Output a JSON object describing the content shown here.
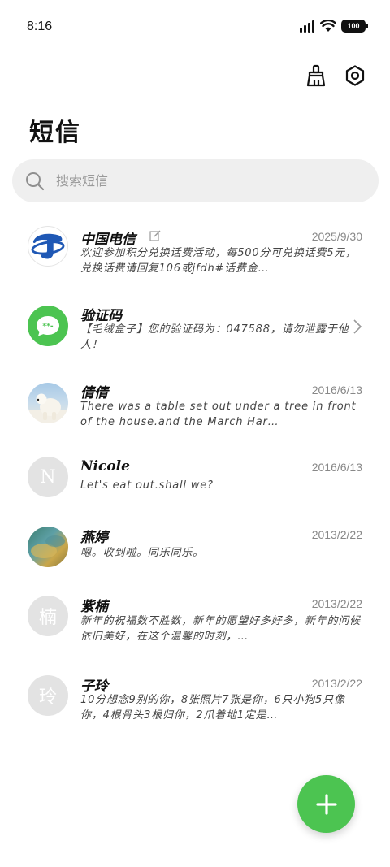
{
  "status_bar": {
    "time": "8:16",
    "battery": "100"
  },
  "header": {
    "title": "短信"
  },
  "search": {
    "placeholder": "搜索短信"
  },
  "messages": [
    {
      "name": "中国电信",
      "date": "2025/9/30",
      "preview": "欢迎参加积分兑换话费活动，每500分可兑换话费5元，兑换话费请回复106或jfdh#话费金…",
      "avatar": "china-telecom-logo"
    },
    {
      "name": "验证码",
      "date": "",
      "preview": "【毛绒盒子】您的验证码为：047588，请勿泄露于他人！",
      "avatar": "message-bubble"
    },
    {
      "name": "倩倩",
      "date": "2016/6/13",
      "preview": "There was a table set out under a tree in front of the house.and the March Har…",
      "avatar": "polar-bear-photo"
    },
    {
      "name": "Nicole",
      "date": "2016/6/13",
      "preview": "Let's eat out.shall we?",
      "avatar_letter": "N"
    },
    {
      "name": "燕婷",
      "date": "2013/2/22",
      "preview": "嗯。收到啦。同乐同乐。",
      "avatar": "landscape-photo"
    },
    {
      "name": "紫楠",
      "date": "2013/2/22",
      "preview": "新年的祝福数不胜数，新年的愿望好多好多，新年的问候依旧美好，在这个温馨的时刻，…",
      "avatar_letter": "楠"
    },
    {
      "name": "子玲",
      "date": "2013/2/22",
      "preview": "10分想念9别的你，8张照片7张是你，6只小狗5只像你，4根骨头3根归你，2爪着地1定是…",
      "avatar_letter": "玲"
    }
  ],
  "colors": {
    "accent": "#4cc451",
    "telecom_blue": "#1f58b5"
  },
  "icons": {
    "clean": "broom-icon",
    "settings": "settings-icon",
    "search": "search-icon",
    "compose": "plus-icon"
  }
}
